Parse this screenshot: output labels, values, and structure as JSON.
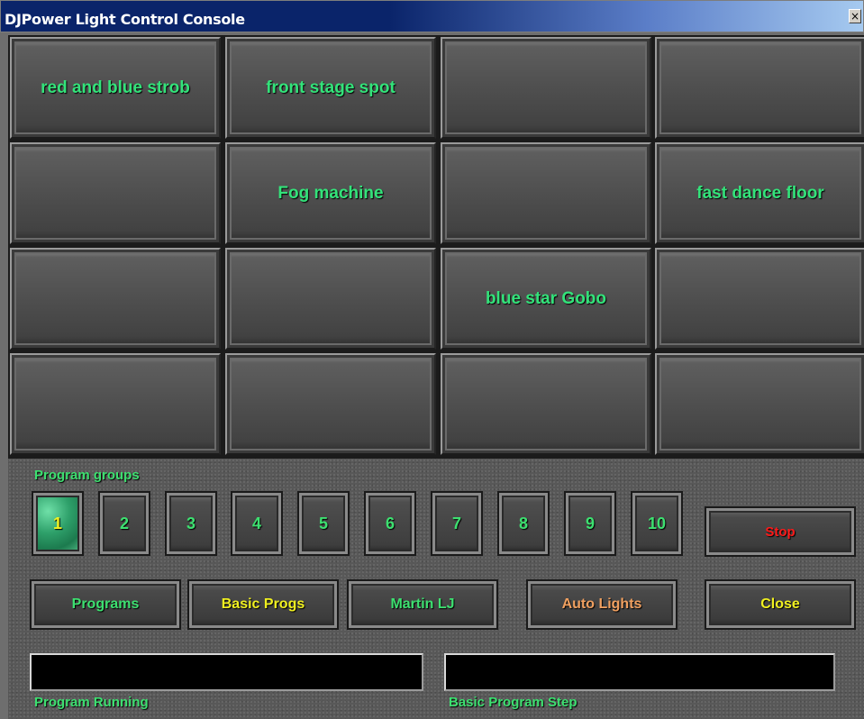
{
  "window": {
    "title": "DJPower Light Control Console",
    "close_glyph": "×"
  },
  "pads": [
    {
      "label": "red and blue strob"
    },
    {
      "label": "front stage spot"
    },
    {
      "label": ""
    },
    {
      "label": ""
    },
    {
      "label": ""
    },
    {
      "label": "Fog machine"
    },
    {
      "label": ""
    },
    {
      "label": "fast dance floor"
    },
    {
      "label": ""
    },
    {
      "label": ""
    },
    {
      "label": "blue star Gobo"
    },
    {
      "label": ""
    },
    {
      "label": ""
    },
    {
      "label": ""
    },
    {
      "label": ""
    },
    {
      "label": ""
    }
  ],
  "program_groups": {
    "label": "Program groups",
    "buttons": [
      "1",
      "2",
      "3",
      "4",
      "5",
      "6",
      "7",
      "8",
      "9",
      "10"
    ],
    "active": "1"
  },
  "controls": {
    "stop": "Stop",
    "programs": "Programs",
    "basic_progs": "Basic Progs",
    "martin_lj": "Martin LJ",
    "auto_lights": "Auto Lights",
    "close": "Close"
  },
  "displays": {
    "program_running_label": "Program Running",
    "program_running_value": "",
    "basic_step_label": "Basic Program Step",
    "basic_step_value": ""
  },
  "colors": {
    "pad_text": "#33e37a",
    "stop_text": "#ff1a1a",
    "yellow_text": "#f0f020",
    "orange_text": "#f0a060"
  }
}
